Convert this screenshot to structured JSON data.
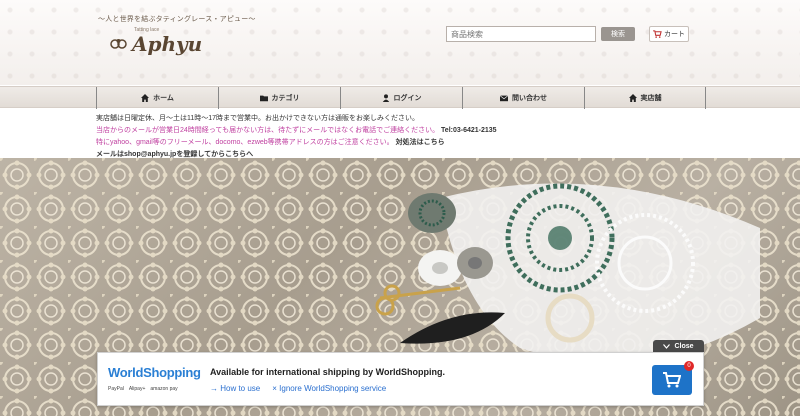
{
  "header": {
    "tagline": "〜人と世界を結ぶタティングレース・アピュー〜",
    "logo_text": "Aphyu",
    "logo_sub": "Tatting lace",
    "search_placeholder": "商品検索",
    "search_label": "検索",
    "cart_label": "カート"
  },
  "nav": {
    "items": [
      {
        "label": "ホーム",
        "icon": "home-icon"
      },
      {
        "label": "カテゴリ",
        "icon": "folder-icon"
      },
      {
        "label": "ログイン",
        "icon": "user-icon"
      },
      {
        "label": "問い合わせ",
        "icon": "envelope-icon"
      },
      {
        "label": "実店舗",
        "icon": "home-icon"
      }
    ]
  },
  "notice": {
    "line1": "実店舗は日曜定休、月～土は11時～17時まで営業中。お出かけできない方は通販をお楽しみください。",
    "line2_pink": "当店からのメールが営業日24時間経っても届かない方は、待たずにメールではなくお電話でご連絡ください。",
    "line2_phone": "Tel:03-6421-2135",
    "line3_pink": "特にyahoo、gmail等のフリーメール、docomo、ezweb等携帯アドレスの方はご注意ください。",
    "line3_link": "対処法はこちら",
    "line4": "メールはshop@aphyu.jpを登録してからこちらへ"
  },
  "worldshopping": {
    "close_label": "Close",
    "logo_text": "WorldShopping",
    "payments": [
      "PayPal",
      "Alipay+",
      "amazon pay"
    ],
    "title": "Available for international shipping by WorldShopping.",
    "how_to_use": "How to use",
    "ignore": "Ignore WorldShopping service",
    "cart_count": "0"
  },
  "colors": {
    "accent_pink": "#c040a0",
    "ws_blue": "#1e73c8",
    "nav_bg": "#e8e3de"
  }
}
